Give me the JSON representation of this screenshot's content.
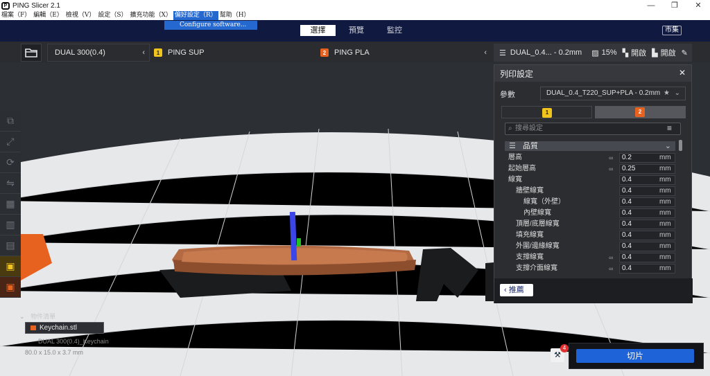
{
  "window": {
    "title": "PING Slicer 2.1",
    "controls": [
      "—",
      "❐",
      "✕"
    ]
  },
  "menu": {
    "items": [
      "檔案（F）",
      "編輯（E）",
      "檢視（V）",
      "設定（S）",
      "擴充功能（X）",
      "偏好設定（R）",
      "幫助（H）"
    ],
    "active_index": 5,
    "dropdown_item": "Configure software..."
  },
  "topnav": {
    "tabs": [
      "選擇",
      "預覽",
      "監控"
    ],
    "active_index": 0,
    "market": "市集"
  },
  "printer": {
    "machine": "DUAL 300(0.4)",
    "extruder1": {
      "num": "1",
      "label": "PING SUP",
      "color": "#f1c31d"
    },
    "extruder2": {
      "num": "2",
      "label": "PING PLA",
      "color": "#e8621f"
    },
    "profile_summary": "DUAL_0.4... - 0.2mm",
    "infill": "15%",
    "support": "開啟",
    "adhesion": "開啟"
  },
  "panel": {
    "title": "列印設定",
    "param_label": "參數",
    "preset": "DUAL_0.4_T220_SUP+PLA - 0.2mm",
    "search_placeholder": "搜尋設定",
    "section": "品質",
    "rows": [
      {
        "label": "層高",
        "value": "0.2",
        "unit": "mm",
        "indent": 0,
        "link": true
      },
      {
        "label": "起始層高",
        "value": "0.25",
        "unit": "mm",
        "indent": 0,
        "link": true
      },
      {
        "label": "線寬",
        "value": "0.4",
        "unit": "mm",
        "indent": 0,
        "link": false
      },
      {
        "label": "牆壁線寬",
        "value": "0.4",
        "unit": "mm",
        "indent": 1,
        "link": false
      },
      {
        "label": "線寬（外壁）",
        "value": "0.4",
        "unit": "mm",
        "indent": 2,
        "link": false
      },
      {
        "label": "內壁線寬",
        "value": "0.4",
        "unit": "mm",
        "indent": 2,
        "link": false
      },
      {
        "label": "頂層/底層線寬",
        "value": "0.4",
        "unit": "mm",
        "indent": 1,
        "link": false
      },
      {
        "label": "填充線寬",
        "value": "0.4",
        "unit": "mm",
        "indent": 1,
        "link": false
      },
      {
        "label": "外圍/邊緣線寬",
        "value": "0.4",
        "unit": "mm",
        "indent": 1,
        "link": false
      },
      {
        "label": "支撐線寬",
        "value": "0.4",
        "unit": "mm",
        "indent": 1,
        "link": true
      },
      {
        "label": "支撐介面線寬",
        "value": "0.4",
        "unit": "mm",
        "indent": 1,
        "link": true
      }
    ],
    "recommend": "推薦"
  },
  "objects": {
    "header": "物件清單",
    "file": "Keychain.stl",
    "job": "DUAL 300(0.4)_Keychain",
    "dims": "80.0 x 15.0 x 3.7 mm"
  },
  "slice": {
    "label": "切片",
    "badge": "4"
  }
}
